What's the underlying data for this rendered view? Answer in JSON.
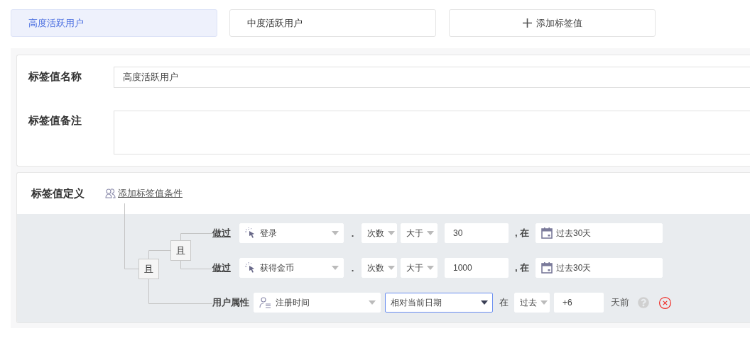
{
  "tabs": [
    {
      "label": "高度活跃用户",
      "selected": true
    },
    {
      "label": "中度活跃用户",
      "selected": false
    }
  ],
  "add_tab_button": {
    "label": "添加标签值"
  },
  "basic_form": {
    "name_label": "标签值名称",
    "name_value": "高度活跃用户",
    "remark_label": "标签值备注"
  },
  "definition": {
    "title": "标签值定义",
    "add_condition_link": "添加标签值条件",
    "outer_operator": "且",
    "inner_operator": "且",
    "conditions": [
      {
        "kind": "event",
        "label": "做过",
        "event": "登录",
        "separator": ".",
        "metric": "次数",
        "comparator": "大于",
        "value": "30",
        "in_label": ", 在",
        "period": "过去30天"
      },
      {
        "kind": "event",
        "label": "做过",
        "event": "获得金币",
        "separator": ".",
        "metric": "次数",
        "comparator": "大于",
        "value": "1000",
        "in_label": ", 在",
        "period": "过去30天"
      },
      {
        "kind": "property",
        "label": "用户属性",
        "property": "注册时间",
        "mode": "相对当前日期",
        "mode_focused": true,
        "in_label": "在",
        "direction": "过去",
        "value": "+6",
        "unit": "天前"
      }
    ]
  }
}
